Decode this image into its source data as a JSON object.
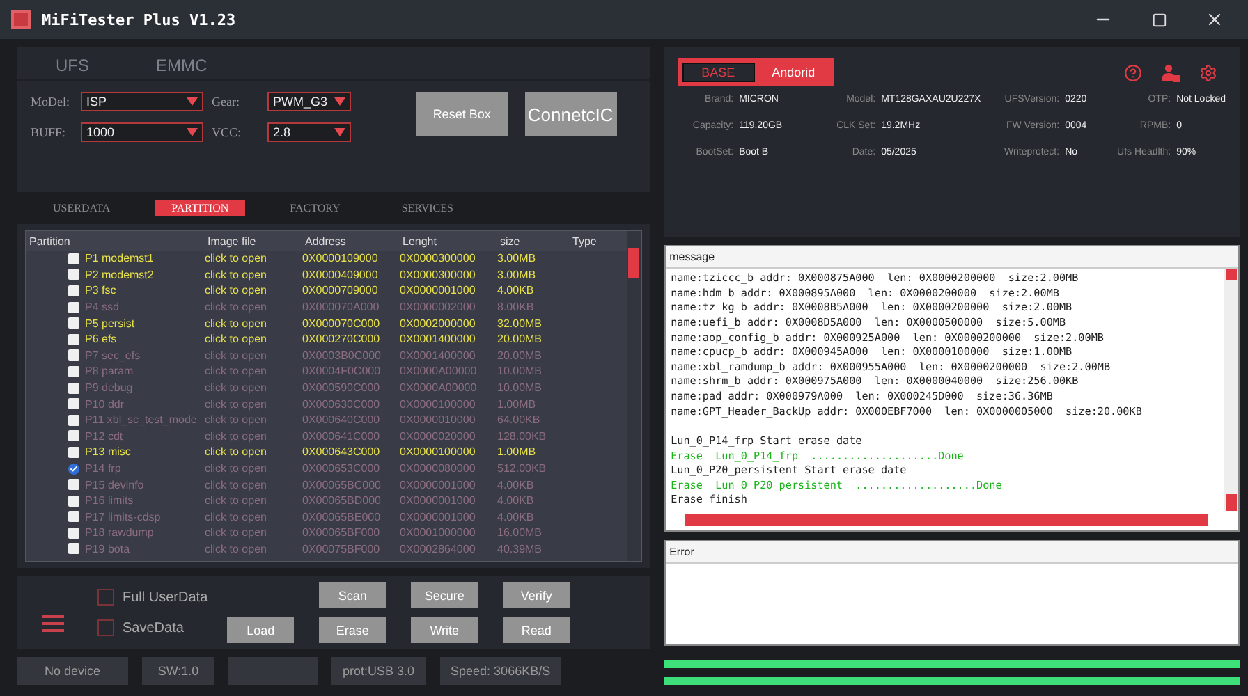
{
  "window": {
    "title": "MiFiTester Plus V1.23"
  },
  "mode_tabs": [
    {
      "label": "UFS",
      "selected": false
    },
    {
      "label": "EMMC",
      "selected": false
    }
  ],
  "settings": [
    {
      "label": "MoDel:",
      "value": "ISP"
    },
    {
      "label": "Gear:",
      "value": "PWM_G3"
    },
    {
      "label": "BUFF:",
      "value": "1000"
    },
    {
      "label": "VCC:",
      "value": "2.8"
    }
  ],
  "top_buttons": [
    "Reset Box",
    "ConnetcIC"
  ],
  "sub_tabs": [
    {
      "label": "USERDATA",
      "selected": false
    },
    {
      "label": "PARTITION",
      "selected": true
    },
    {
      "label": "FACTORY",
      "selected": false
    },
    {
      "label": "SERVICES",
      "selected": false
    }
  ],
  "table": {
    "columns": [
      "Partition",
      "Image file",
      "Address",
      "Lenght",
      "size",
      "Type"
    ],
    "rows": [
      {
        "name": "P1 modemst1",
        "image": "click to open",
        "address": "0X0000109000",
        "length": "0X0000300000",
        "size": "3.00MB",
        "highlighted": true,
        "checked": false
      },
      {
        "name": "P2 modemst2",
        "image": "click to open",
        "address": "0X0000409000",
        "length": "0X0000300000",
        "size": "3.00MB",
        "highlighted": true,
        "checked": false
      },
      {
        "name": "P3 fsc",
        "image": "click to open",
        "address": "0X0000709000",
        "length": "0X0000001000",
        "size": "4.00KB",
        "highlighted": true,
        "checked": false
      },
      {
        "name": "P4 ssd",
        "image": "click to open",
        "address": "0X000070A000",
        "length": "0X0000002000",
        "size": "8.00KB",
        "highlighted": false,
        "checked": false
      },
      {
        "name": "P5 persist",
        "image": "click to open",
        "address": "0X000070C000",
        "length": "0X0002000000",
        "size": "32.00MB",
        "highlighted": true,
        "checked": false
      },
      {
        "name": "P6 efs",
        "image": "click to open",
        "address": "0X000270C000",
        "length": "0X0001400000",
        "size": "20.00MB",
        "highlighted": true,
        "checked": false
      },
      {
        "name": "P7 sec_efs",
        "image": "click to open",
        "address": "0X0003B0C000",
        "length": "0X0001400000",
        "size": "20.00MB",
        "highlighted": false,
        "checked": false
      },
      {
        "name": "P8 param",
        "image": "click to open",
        "address": "0X0004F0C000",
        "length": "0X0000A00000",
        "size": "10.00MB",
        "highlighted": false,
        "checked": false
      },
      {
        "name": "P9 debug",
        "image": "click to open",
        "address": "0X000590C000",
        "length": "0X0000A00000",
        "size": "10.00MB",
        "highlighted": false,
        "checked": false
      },
      {
        "name": "P10 ddr",
        "image": "click to open",
        "address": "0X000630C000",
        "length": "0X0000100000",
        "size": "1.00MB",
        "highlighted": false,
        "checked": false
      },
      {
        "name": "P11 xbl_sc_test_mode",
        "image": "click to open",
        "address": "0X000640C000",
        "length": "0X0000010000",
        "size": "64.00KB",
        "highlighted": false,
        "checked": false
      },
      {
        "name": "P12 cdt",
        "image": "click to open",
        "address": "0X000641C000",
        "length": "0X0000020000",
        "size": "128.00KB",
        "highlighted": false,
        "checked": false
      },
      {
        "name": "P13 misc",
        "image": "click to open",
        "address": "0X000643C000",
        "length": "0X0000100000",
        "size": "1.00MB",
        "highlighted": true,
        "checked": false
      },
      {
        "name": "P14 frp",
        "image": "click to open",
        "address": "0X000653C000",
        "length": "0X0000080000",
        "size": "512.00KB",
        "highlighted": false,
        "checked": true
      },
      {
        "name": "P15 devinfo",
        "image": "click to open",
        "address": "0X00065BC000",
        "length": "0X0000001000",
        "size": "4.00KB",
        "highlighted": false,
        "checked": false
      },
      {
        "name": "P16 limits",
        "image": "click to open",
        "address": "0X00065BD000",
        "length": "0X0000001000",
        "size": "4.00KB",
        "highlighted": false,
        "checked": false
      },
      {
        "name": "P17 limits-cdsp",
        "image": "click to open",
        "address": "0X00065BE000",
        "length": "0X0000001000",
        "size": "4.00KB",
        "highlighted": false,
        "checked": false
      },
      {
        "name": "P18 rawdump",
        "image": "click to open",
        "address": "0X00065BF000",
        "length": "0X0001000000",
        "size": "16.00MB",
        "highlighted": false,
        "checked": false
      },
      {
        "name": "P19 bota",
        "image": "click to open",
        "address": "0X00075BF000",
        "length": "0X0002864000",
        "size": "40.39MB",
        "highlighted": false,
        "checked": false
      }
    ]
  },
  "options": [
    {
      "label": "Full UserData",
      "checked": false
    },
    {
      "label": "SaveData",
      "checked": false
    }
  ],
  "action_buttons": [
    "Scan",
    "Secure",
    "Verify",
    "Load",
    "Erase",
    "Write",
    "Read"
  ],
  "status_bar": [
    "No device",
    "SW:1.0",
    "prot:USB 3.0",
    "Speed: 3066KB/S"
  ],
  "device_tabs": [
    {
      "label": "BASE",
      "selected": true
    },
    {
      "label": "Andorid",
      "selected": false
    }
  ],
  "device_info": [
    {
      "label": "Brand:",
      "value": "MICRON"
    },
    {
      "label": "Model:",
      "value": "MT128GAXAU2U227X"
    },
    {
      "label": "UFSVersion:",
      "value": "0220"
    },
    {
      "label": "OTP:",
      "value": "Not Locked"
    },
    {
      "label": "Capacity:",
      "value": "119.20GB"
    },
    {
      "label": "CLK Set:",
      "value": "19.2MHz"
    },
    {
      "label": "FW Version:",
      "value": "0004"
    },
    {
      "label": "RPMB:",
      "value": "0"
    },
    {
      "label": "BootSet:",
      "value": "Boot B"
    },
    {
      "label": "Date:",
      "value": "05/2025"
    },
    {
      "label": "Writeprotect:",
      "value": "No"
    },
    {
      "label": "Ufs Headlth:",
      "value": "90%"
    }
  ],
  "message": {
    "title": "message",
    "lines": [
      {
        "kind": "info",
        "text": "name:tziccc_b addr: 0X000875A000  len: 0X0000200000  size:2.00MB"
      },
      {
        "kind": "info",
        "text": "name:hdm_b addr: 0X000895A000  len: 0X0000200000  size:2.00MB"
      },
      {
        "kind": "info",
        "text": "name:tz_kg_b addr: 0X0008B5A000  len: 0X0000200000  size:2.00MB"
      },
      {
        "kind": "info",
        "text": "name:uefi_b addr: 0X0008D5A000  len: 0X0000500000  size:5.00MB"
      },
      {
        "kind": "info",
        "text": "name:aop_config_b addr: 0X000925A000  len: 0X0000200000  size:2.00MB"
      },
      {
        "kind": "info",
        "text": "name:cpucp_b addr: 0X000945A000  len: 0X0000100000  size:1.00MB"
      },
      {
        "kind": "info",
        "text": "name:xbl_ramdump_b addr: 0X000955A000  len: 0X0000200000  size:2.00MB"
      },
      {
        "kind": "info",
        "text": "name:shrm_b addr: 0X000975A000  len: 0X0000040000  size:256.00KB"
      },
      {
        "kind": "info",
        "text": "name:pad addr: 0X000979A000  len: 0X000245D000  size:36.36MB"
      },
      {
        "kind": "info",
        "text": "name:GPT_Header_BackUp addr: 0X000EBF7000  len: 0X0000005000  size:20.00KB"
      },
      {
        "kind": "gap"
      },
      {
        "kind": "info",
        "text": "Lun_0_P14_frp Start erase date"
      },
      {
        "kind": "success",
        "text": "Erase  Lun_0_P14_frp  ....................Done"
      },
      {
        "kind": "info",
        "text": "Lun_0_P20_persistent Start erase date"
      },
      {
        "kind": "success",
        "text": "Erase  Lun_0_P20_persistent  ...................Done"
      },
      {
        "kind": "info",
        "text": "Erase finish"
      }
    ],
    "progress": {
      "level": 1
    }
  },
  "error": {
    "title": "Error"
  },
  "bottom_bars": [
    {
      "level": 1
    },
    {
      "level": 1
    }
  ]
}
